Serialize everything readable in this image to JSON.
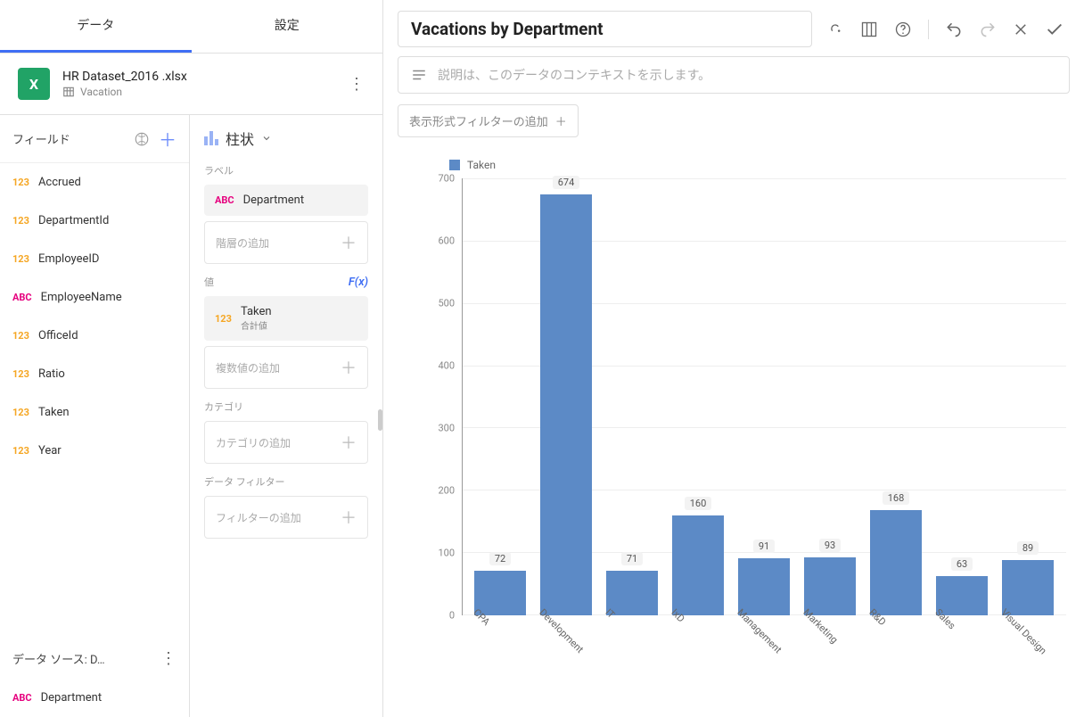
{
  "tabs": {
    "data": "データ",
    "settings": "設定"
  },
  "datasource": {
    "file": "HR Dataset_2016 .xlsx",
    "table": "Vacation"
  },
  "fields": {
    "header": "フィールド",
    "items": [
      {
        "type": "123",
        "cls": "t-num",
        "name": "Accrued"
      },
      {
        "type": "123",
        "cls": "t-num",
        "name": "DepartmentId"
      },
      {
        "type": "123",
        "cls": "t-num",
        "name": "EmployeeID"
      },
      {
        "type": "ABC",
        "cls": "t-txt",
        "name": "EmployeeName"
      },
      {
        "type": "123",
        "cls": "t-num",
        "name": "OfficeId"
      },
      {
        "type": "123",
        "cls": "t-num",
        "name": "Ratio"
      },
      {
        "type": "123",
        "cls": "t-num",
        "name": "Taken"
      },
      {
        "type": "123",
        "cls": "t-num",
        "name": "Year"
      }
    ],
    "dsFooter": "データ ソース: D…",
    "extra": [
      {
        "type": "ABC",
        "cls": "t-txt",
        "name": "Department"
      }
    ]
  },
  "builder": {
    "chartType": "柱状",
    "labelSection": "ラベル",
    "labelChip": "Department",
    "addHierarchy": "階層の追加",
    "valueSection": "値",
    "valueChip": "Taken",
    "valueAgg": "合計値",
    "addValues": "複数値の追加",
    "categorySection": "カテゴリ",
    "addCategory": "カテゴリの追加",
    "filterSection": "データ フィルター",
    "addFilter": "フィルターの追加"
  },
  "viz": {
    "title": "Vacations by Department",
    "descPlaceholder": "説明は、このデータのコンテキストを示します。",
    "addVizFilter": "表示形式フィルターの追加",
    "legend": "Taken"
  },
  "chart_data": {
    "type": "bar",
    "title": "Vacations by Department",
    "xlabel": "",
    "ylabel": "",
    "ylim": [
      0,
      700
    ],
    "yticks": [
      0,
      100,
      200,
      300,
      400,
      500,
      600,
      700
    ],
    "categories": [
      "CPA",
      "Development",
      "IT",
      "IxD",
      "Management",
      "Marketing",
      "R&D",
      "Sales",
      "Visual Design"
    ],
    "values": [
      72,
      674,
      71,
      160,
      91,
      93,
      168,
      63,
      89
    ],
    "series_name": "Taken",
    "color": "#5c8ac6"
  }
}
